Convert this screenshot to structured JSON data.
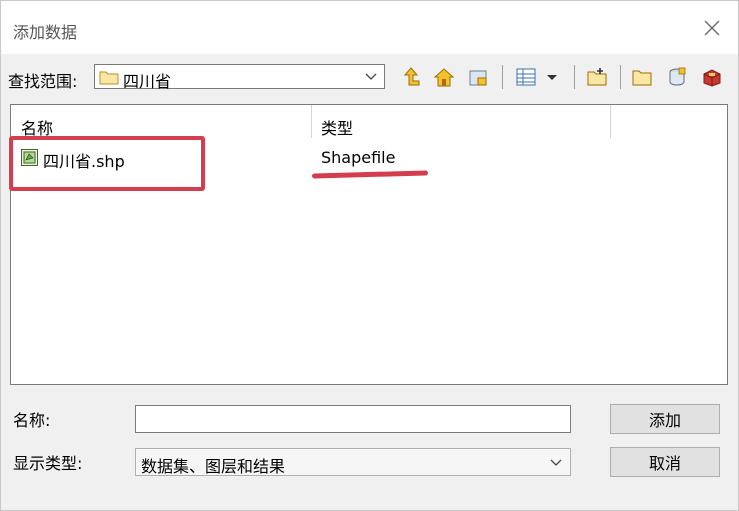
{
  "window": {
    "title": "添加数据"
  },
  "toolbar": {
    "lookin_label": "查找范围:",
    "lookin_value": "四川省",
    "icons": [
      "up-one-level-icon",
      "home-icon",
      "connect-folder-icon",
      "view-options-icon",
      "dropdown-arrow-icon",
      "new-folder-icon",
      "folder-icon",
      "database-icon",
      "toolbox-icon"
    ]
  },
  "filelist": {
    "columns": [
      "名称",
      "类型"
    ],
    "rows": [
      {
        "name": "四川省.shp",
        "type": "Shapefile"
      }
    ]
  },
  "form": {
    "name_label": "名称:",
    "name_value": "",
    "type_label": "显示类型:",
    "type_value": "数据集、图层和结果"
  },
  "buttons": {
    "add": "添加",
    "cancel": "取消"
  },
  "annotation": {
    "color": "#d43d4d"
  }
}
